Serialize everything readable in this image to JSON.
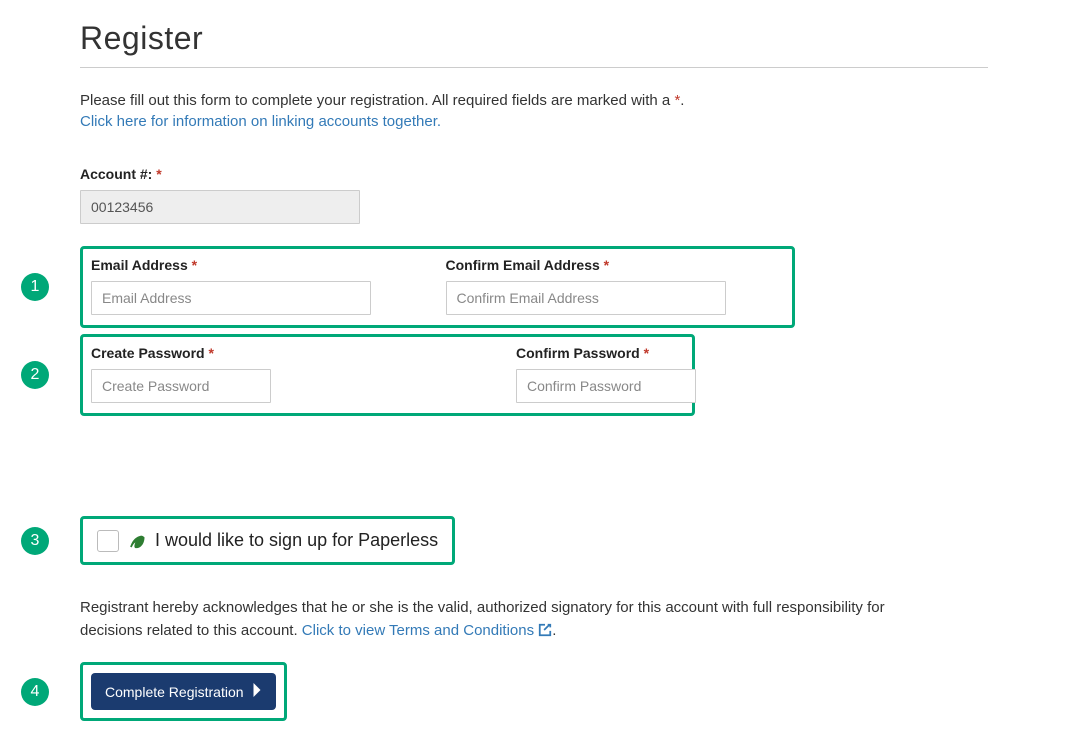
{
  "heading": "Register",
  "intro_text": "Please fill out this form to complete your registration. All required fields are marked with a ",
  "intro_asterisk": "*",
  "intro_period": ".",
  "linking_link_text": "Click here for information on linking accounts together.",
  "account": {
    "label": "Account #:",
    "value": "00123456"
  },
  "email_row": {
    "email_label": "Email Address",
    "email_placeholder": "Email Address",
    "confirm_label": "Confirm Email Address",
    "confirm_placeholder": "Confirm Email Address"
  },
  "password_row": {
    "create_label": "Create Password",
    "create_placeholder": "Create Password",
    "confirm_label": "Confirm Password",
    "confirm_placeholder": "Confirm Password"
  },
  "paperless_label": "I would like to sign up for Paperless",
  "terms_text_pre": "Registrant hereby acknowledges that he or she is the valid, authorized signatory for this account with full responsibility for decisions related to this account. ",
  "terms_link_text": "Click to view Terms and Conditions",
  "terms_period": ".",
  "submit_label": "Complete Registration",
  "steps": {
    "s1": "1",
    "s2": "2",
    "s3": "3",
    "s4": "4"
  },
  "required_mark": " *"
}
